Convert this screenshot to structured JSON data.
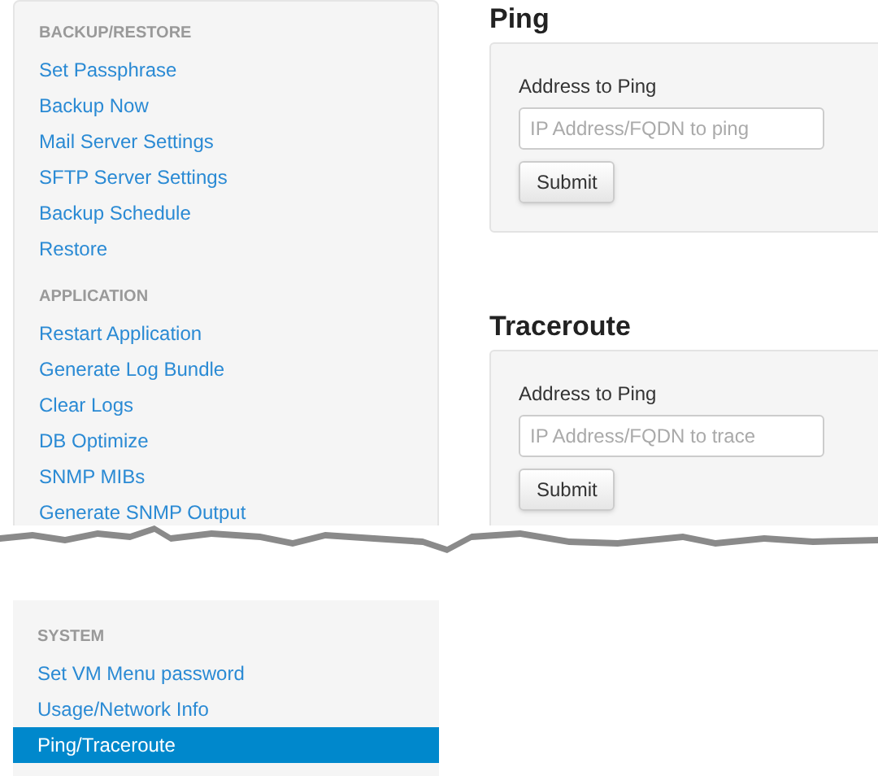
{
  "sidebar": {
    "top_sections": [
      {
        "title": "BACKUP/RESTORE",
        "items": [
          {
            "label": "Set Passphrase",
            "selected": false
          },
          {
            "label": "Backup Now",
            "selected": false
          },
          {
            "label": "Mail Server Settings",
            "selected": false
          },
          {
            "label": "SFTP Server Settings",
            "selected": false
          },
          {
            "label": "Backup Schedule",
            "selected": false
          },
          {
            "label": "Restore",
            "selected": false
          }
        ]
      },
      {
        "title": "APPLICATION",
        "items": [
          {
            "label": "Restart Application",
            "selected": false
          },
          {
            "label": "Generate Log Bundle",
            "selected": false
          },
          {
            "label": "Clear Logs",
            "selected": false
          },
          {
            "label": "DB Optimize",
            "selected": false
          },
          {
            "label": "SNMP MIBs",
            "selected": false
          },
          {
            "label": "Generate SNMP Output",
            "selected": false
          }
        ]
      }
    ],
    "bottom_sections": [
      {
        "title": "SYSTEM",
        "items": [
          {
            "label": "Set VM Menu password",
            "selected": false
          },
          {
            "label": "Usage/Network Info",
            "selected": false
          },
          {
            "label": "Ping/Traceroute",
            "selected": true
          }
        ]
      }
    ]
  },
  "forms": [
    {
      "title": "Ping",
      "label": "Address to Ping",
      "placeholder": "IP Address/FQDN to ping",
      "button": "Submit"
    },
    {
      "title": "Traceroute",
      "label": "Address to Ping",
      "placeholder": "IP Address/FQDN to trace",
      "button": "Submit"
    }
  ]
}
